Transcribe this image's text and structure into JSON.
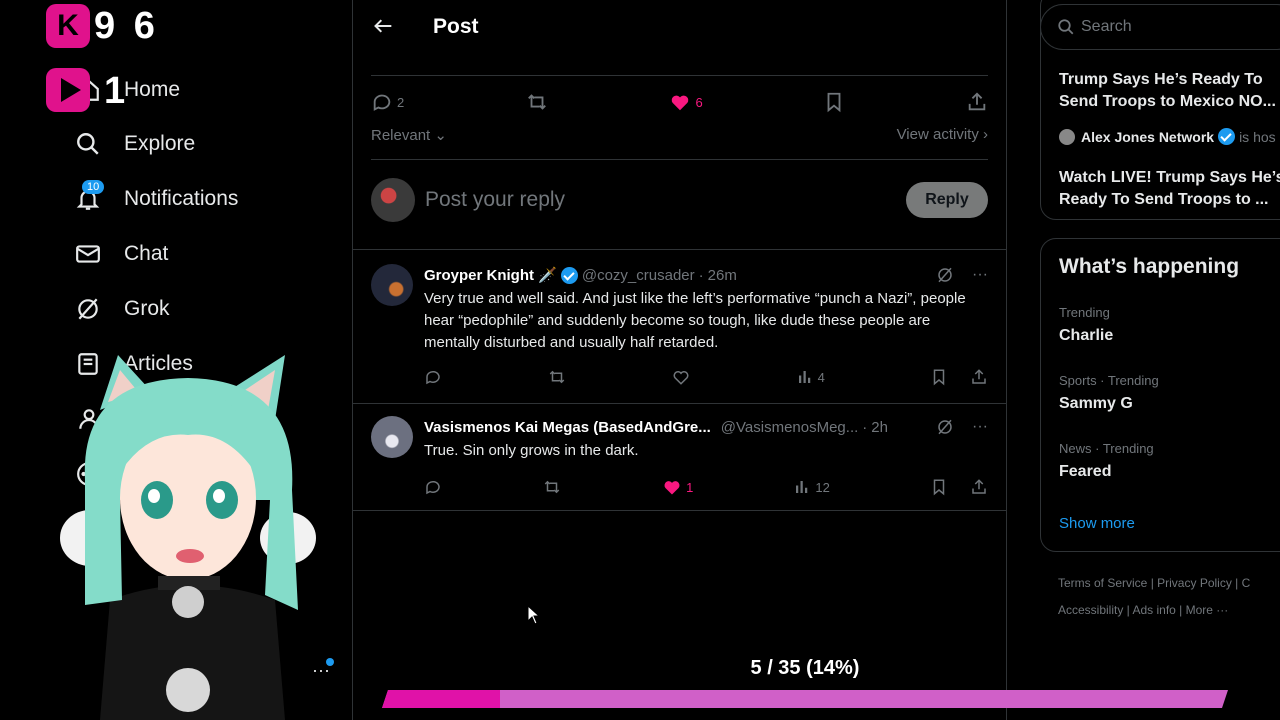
{
  "overlay": {
    "counter_top": "9 6",
    "counter_second": "1",
    "progress_text": "5 / 35 (14%)",
    "progress_fraction": 0.14,
    "accent_color": "#e0128c"
  },
  "nav": {
    "items": [
      {
        "label": "Home",
        "icon": "home-icon"
      },
      {
        "label": "Explore",
        "icon": "search-icon"
      },
      {
        "label": "Notifications",
        "icon": "bell-icon"
      },
      {
        "label": "Chat",
        "icon": "mail-icon"
      },
      {
        "label": "Grok",
        "icon": "grok-icon"
      },
      {
        "label": "Articles",
        "icon": "article-icon"
      }
    ],
    "notification_badge": "10"
  },
  "post": {
    "title": "Post",
    "stats": {
      "replies": "2",
      "likes": "6"
    },
    "sort_label": "Relevant",
    "view_activity": "View activity",
    "reply_placeholder": "Post your reply",
    "reply_button": "Reply"
  },
  "replies": [
    {
      "name": "Groyper Knight 🗡️",
      "handle": "@cozy_crusader",
      "time": "26m",
      "text": "Very true and well said. And just like the left’s performative “punch a Nazi”, people hear “pedophile” and suddenly become so tough, like dude these people are mentally disturbed and usually half retarded.",
      "likes": "",
      "views": "4"
    },
    {
      "name": "Vasismenos Kai Megas (BasedAndGre...",
      "handle": "@VasismenosMeg...",
      "time": "2h",
      "text": "True. Sin only grows in the dark.",
      "likes": "1",
      "views": "12"
    }
  ],
  "right": {
    "search_placeholder": "Search",
    "news_headline_1a": "Trump Says He’s Ready To",
    "news_headline_1b": "Send Troops to Mexico NO...",
    "news_source": "Alex Jones Network",
    "news_source_suffix": "is hos",
    "news_headline_2a": "Watch LIVE! Trump Says He’s",
    "news_headline_2b": "Ready To Send Troops to ...",
    "whats_happening": "What’s happening",
    "trends": [
      {
        "category": "Trending",
        "name": "Charlie"
      },
      {
        "category": "Sports · Trending",
        "name": "Sammy G"
      },
      {
        "category": "News · Trending",
        "name": "Feared"
      }
    ],
    "show_more": "Show more",
    "footer_line1": "Terms of Service  |  Privacy Policy  |  C",
    "footer_line2": "Accessibility  |  Ads info  |  More ···"
  }
}
